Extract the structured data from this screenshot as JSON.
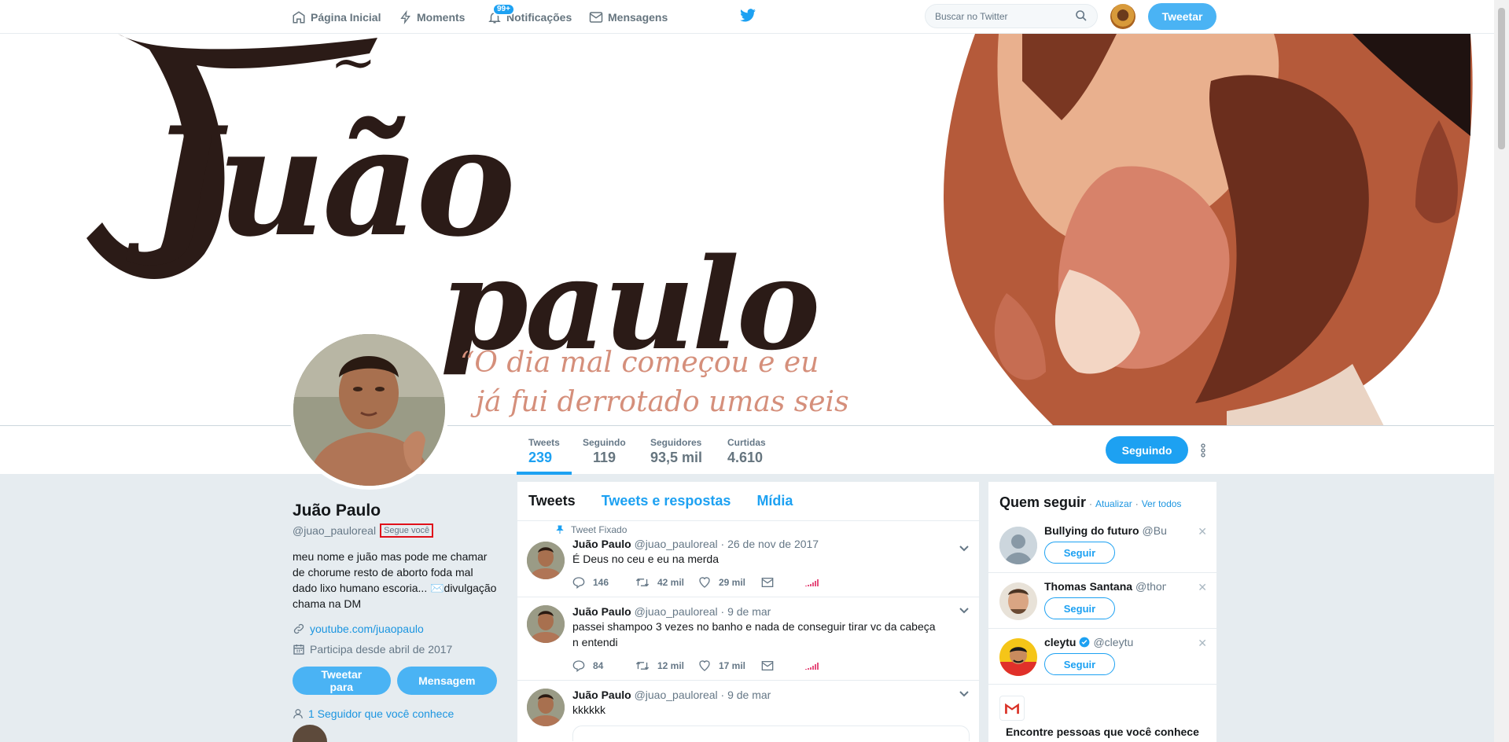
{
  "nav": {
    "home": "Página Inicial",
    "moments": "Moments",
    "notifications": "Notificações",
    "notifications_badge": "99+",
    "messages": "Mensagens",
    "search_placeholder": "Buscar no Twitter",
    "tweet_button": "Tweetar"
  },
  "banner": {
    "title_line1": "Juão",
    "title_line2": "paulo",
    "quote_line1": "“O dia mal começou e eu",
    "quote_line2": "já fui derrotado umas seis"
  },
  "stats": [
    {
      "label": "Tweets",
      "value": "239"
    },
    {
      "label": "Seguindo",
      "value": "119"
    },
    {
      "label": "Seguidores",
      "value": "93,5 mil"
    },
    {
      "label": "Curtidas",
      "value": "4.610"
    }
  ],
  "profile": {
    "following_button": "Seguindo",
    "name": "Juão Paulo",
    "handle": "@juao_pauloreal",
    "follows_you": "Segue você",
    "bio": "meu nome e juão mas pode me chamar de chorume resto de aborto foda mal dado lixo humano escoria... ✉️divulgação chama na DM",
    "link": "youtube.com/juaopaulo",
    "joined": "Participa desde abril de 2017",
    "tweet_to_button": "Tweetar para",
    "message_button": "Mensagem",
    "followers_you_know": "1 Seguidor que você conhece"
  },
  "timeline": {
    "tabs": [
      "Tweets",
      "Tweets e respostas",
      "Mídia"
    ],
    "pinned_label": "Tweet Fixado",
    "tweets": [
      {
        "name": "Juão Paulo",
        "handle": "@juao_pauloreal",
        "date": "· 26 de nov de 2017",
        "text": "É Deus no ceu e eu na merda",
        "replies": "146",
        "retweets": "42 mil",
        "likes": "29 mil"
      },
      {
        "name": "Juão Paulo",
        "handle": "@juao_pauloreal",
        "date": "· 9 de mar",
        "text": "passei shampoo 3 vezes no banho e nada de conseguir tirar vc da cabeça  n entendi",
        "replies": "84",
        "retweets": "12 mil",
        "likes": "17 mil"
      },
      {
        "name": "Juão Paulo",
        "handle": "@juao_pauloreal",
        "date": "· 9 de mar",
        "text": "kkkkkk"
      }
    ]
  },
  "who_to_follow": {
    "title": "Quem seguir",
    "refresh": "Atualizar",
    "view_all": "Ver todos",
    "follow_label": "Seguir",
    "suggestions": [
      {
        "name": "Bullying do futuro",
        "handle": "@Bully..."
      },
      {
        "name": "Thomas Santana",
        "handle": "@thoma..."
      },
      {
        "name": "cleytu",
        "handle": "@cleytu",
        "verified": true
      }
    ],
    "find_people": "Encontre pessoas que você conhece"
  },
  "colors": {
    "accent": "#1da1f2",
    "button": "#4ab3f4",
    "follows_you_border": "#e0101a"
  }
}
